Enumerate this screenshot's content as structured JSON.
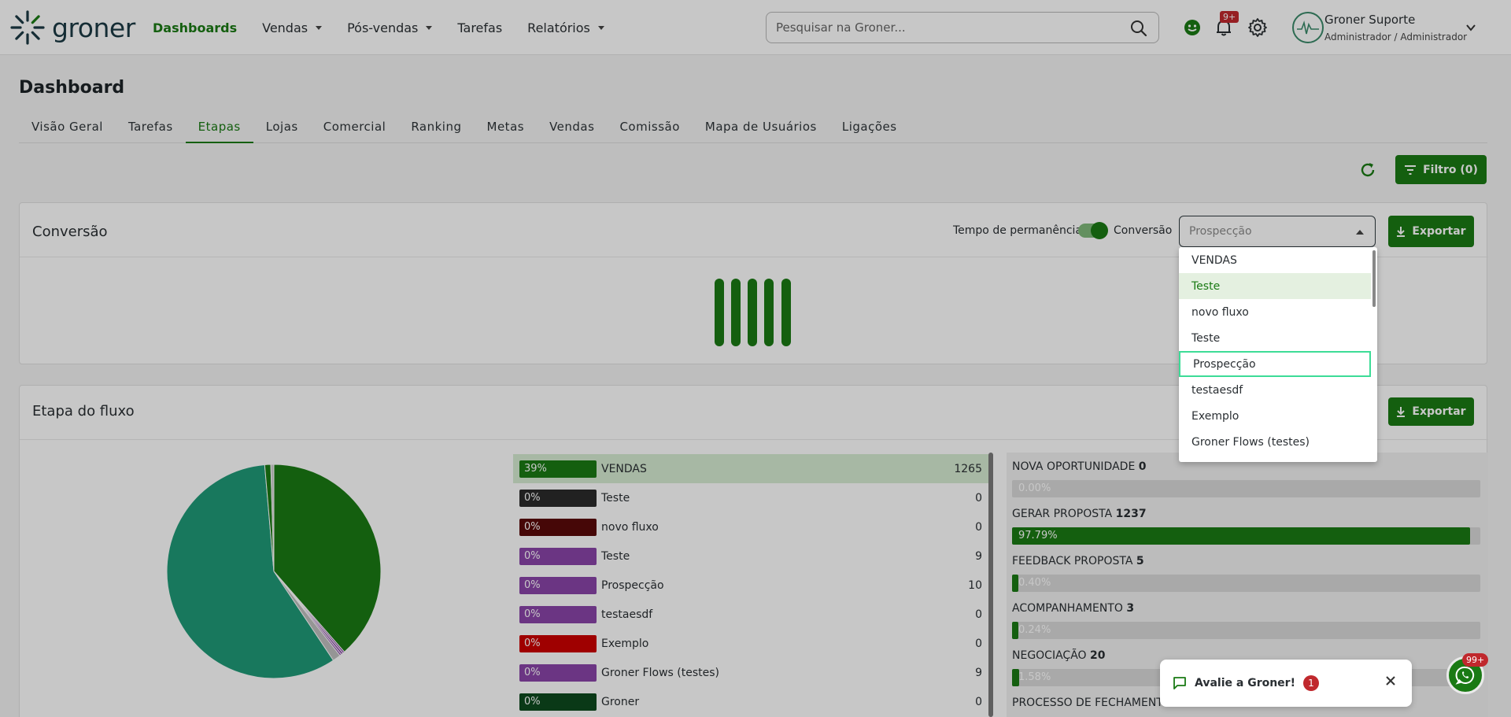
{
  "brand": {
    "name": "groner",
    "accent": "#1a7a14"
  },
  "nav": [
    {
      "label": "Dashboards",
      "active": true,
      "caret": false
    },
    {
      "label": "Vendas",
      "active": false,
      "caret": true
    },
    {
      "label": "Pós-vendas",
      "active": false,
      "caret": true
    },
    {
      "label": "Tarefas",
      "active": false,
      "caret": false
    },
    {
      "label": "Relatórios",
      "active": false,
      "caret": true
    }
  ],
  "search": {
    "placeholder": "Pesquisar na Groner..."
  },
  "notifications": {
    "count": "9+"
  },
  "user": {
    "name": "Groner Suporte",
    "role": "Administrador / Administrador"
  },
  "page": {
    "title": "Dashboard"
  },
  "tabs": [
    "Visão Geral",
    "Tarefas",
    "Etapas",
    "Lojas",
    "Comercial",
    "Ranking",
    "Metas",
    "Vendas",
    "Comissão",
    "Mapa de Usuários",
    "Ligações"
  ],
  "active_tab": "Etapas",
  "filter_button": "Filtro (0)",
  "conversion": {
    "title": "Conversão",
    "toggle_left": "Tempo de permanência",
    "toggle_right": "Conversão",
    "select_value": "Prospecção",
    "export": "Exportar"
  },
  "dropdown": {
    "options": [
      "VENDAS",
      "Teste",
      "novo fluxo",
      "Teste",
      "Prospecção",
      "testaesdf",
      "Exemplo",
      "Groner Flows (testes)"
    ],
    "hover_index": 1,
    "focus_index": 4
  },
  "flow": {
    "title": "Etapa do fluxo",
    "export": "Exportar",
    "stages": [
      {
        "pct": "39%",
        "name": "VENDAS",
        "count": "1265",
        "color": "#1a7a14"
      },
      {
        "pct": "0%",
        "name": "Teste",
        "count": "0",
        "color": "#2b2b2b"
      },
      {
        "pct": "0%",
        "name": "novo fluxo",
        "count": "0",
        "color": "#5a0a0a"
      },
      {
        "pct": "0%",
        "name": "Teste",
        "count": "9",
        "color": "#8a45a8"
      },
      {
        "pct": "0%",
        "name": "Prospecção",
        "count": "10",
        "color": "#8a45a8"
      },
      {
        "pct": "0%",
        "name": "testaesdf",
        "count": "0",
        "color": "#8a45a8"
      },
      {
        "pct": "0%",
        "name": "Exemplo",
        "count": "0",
        "color": "#cc0000"
      },
      {
        "pct": "0%",
        "name": "Groner Flows (testes)",
        "count": "9",
        "color": "#8a45a8"
      },
      {
        "pct": "0%",
        "name": "Groner",
        "count": "0",
        "color": "#0e4a1e"
      }
    ],
    "substages": [
      {
        "name": "NOVA OPORTUNIDADE",
        "count": "0",
        "pct_text": "0.00%",
        "fill": 0.0
      },
      {
        "name": "GERAR PROPOSTA",
        "count": "1237",
        "pct_text": "97.79%",
        "fill": 0.9779
      },
      {
        "name": "FEEDBACK PROPOSTA",
        "count": "5",
        "pct_text": "0.40%",
        "fill": 0.004
      },
      {
        "name": "ACOMPANHAMENTO",
        "count": "3",
        "pct_text": "0.24%",
        "fill": 0.0024
      },
      {
        "name": "NEGOCIAÇÃO",
        "count": "20",
        "pct_text": "1.58%",
        "fill": 0.0158
      },
      {
        "name": "PROCESSO DE FECHAMENTO",
        "count": "",
        "pct_text": "",
        "fill": 0
      }
    ],
    "pie": [
      {
        "value": 1265,
        "color": "#1a7a14"
      },
      {
        "value": 9,
        "color": "#8a45a8"
      },
      {
        "value": 10,
        "color": "#8a45a8"
      },
      {
        "value": 9,
        "color": "#8a45a8"
      },
      {
        "value": 40,
        "color": "#bfbfbf"
      },
      {
        "value": 1903,
        "color": "#1f9a78"
      },
      {
        "value": 30,
        "color": "#1a7a14"
      },
      {
        "value": 15,
        "color": "#cfcfcf"
      }
    ]
  },
  "toast": {
    "text": "Avalie a Groner!",
    "count": "1"
  },
  "whatsapp": {
    "badge": "99+"
  }
}
